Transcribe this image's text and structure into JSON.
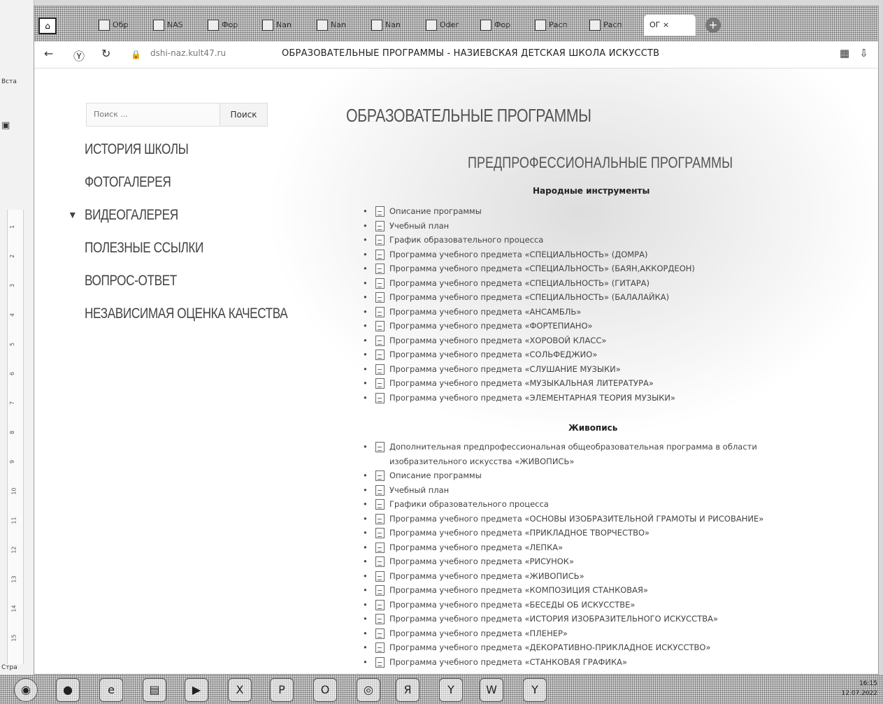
{
  "office": {
    "label_top": "Вста",
    "label_bottom": "Стра"
  },
  "ruler_ticks": [
    "1",
    "2",
    "3",
    "4",
    "5",
    "6",
    "7",
    "8",
    "9",
    "10",
    "11",
    "12",
    "13",
    "14",
    "15"
  ],
  "browser": {
    "tabs": [
      "Обр",
      "NAS",
      "Фор",
      "Nan",
      "Nan",
      "Nan",
      "Oder",
      "Фор",
      "Расп",
      "Расп"
    ],
    "active_tab": "ОГ ×",
    "new_tab": "+",
    "url": "dshi-naz.kult47.ru",
    "title": "ОБРАЗОВАТЕЛЬНЫЕ ПРОГРАММЫ - НАЗИЕВСКАЯ ДЕТСКАЯ ШКОЛА ИСКУССТВ",
    "back": "←",
    "reload": "↻",
    "yandex": "Ⓨ"
  },
  "search": {
    "placeholder": "Поиск ...",
    "button": "Поиск"
  },
  "menu": [
    {
      "label": "ИСТОРИЯ ШКОЛЫ",
      "arrow": false
    },
    {
      "label": "ФОТОГАЛЕРЕЯ",
      "arrow": false
    },
    {
      "label": "ВИДЕОГАЛЕРЕЯ",
      "arrow": true
    },
    {
      "label": "ПОЛЕЗНЫЕ ССЫЛКИ",
      "arrow": false
    },
    {
      "label": "ВОПРОС-ОТВЕТ",
      "arrow": false
    },
    {
      "label": "НЕЗАВИСИМАЯ ОЦЕНКА КАЧЕСТВА",
      "arrow": false
    }
  ],
  "main_title": "ОБРАЗОВАТЕЛЬНЫЕ ПРОГРАММЫ",
  "sub_title": "ПРЕДПРОФЕССИОНАЛЬНЫЕ ПРОГРАММЫ",
  "section1": {
    "heading": "Народные инструменты",
    "items": [
      "Описание программы",
      "Учебный план",
      "График образовательного процесса",
      "Программа учебного предмета «СПЕЦИАЛЬНОСТЬ» (ДОМРА)",
      "Программа учебного предмета «СПЕЦИАЛЬНОСТЬ» (БАЯН,АККОРДЕОН)",
      "Программа учебного предмета «СПЕЦИАЛЬНОСТЬ» (ГИТАРА)",
      "Программа учебного предмета «СПЕЦИАЛЬНОСТЬ» (БАЛАЛАЙКА)",
      "Программа учебного предмета «АНСАМБЛЬ»",
      "Программа учебного предмета «ФОРТЕПИАНО»",
      "Программа учебного предмета «ХОРОВОЙ КЛАСС»",
      "Программа учебного предмета «СОЛЬФЕДЖИО»",
      "Программа учебного предмета «СЛУШАНИЕ МУЗЫКИ»",
      "Программа учебного предмета «МУЗЫКАЛЬНАЯ ЛИТЕРАТУРА»",
      "Программа учебного предмета «ЭЛЕМЕНТАРНАЯ ТЕОРИЯ МУЗЫКИ»"
    ]
  },
  "section2": {
    "heading": "Живопись",
    "items": [
      "Дополнительная предпрофессиональная общеобразовательная программа в области изобразительного искусства «ЖИВОПИСЬ»",
      "Описание программы",
      "Учебный план",
      "Графики образовательного процесса",
      "Программа учебного предмета «ОСНОВЫ ИЗОБРАЗИТЕЛЬНОЙ ГРАМОТЫ И РИСОВАНИЕ»",
      "Программа учебного предмета «ПРИКЛАДНОЕ ТВОРЧЕСТВО»",
      "Программа учебного предмета «ЛЕПКА»",
      "Программа учебного предмета «РИСУНОК»",
      "Программа учебного предмета «ЖИВОПИСЬ»",
      "Программа учебного предмета «КОМПОЗИЦИЯ СТАНКОВАЯ»",
      "Программа учебного предмета «БЕСЕДЫ ОБ ИСКУССТВЕ»",
      "Программа учебного предмета «ИСТОРИЯ ИЗОБРАЗИТЕЛЬНОГО ИСКУССТВА»",
      "Программа учебного предмета «ПЛЕНЕР»",
      "Программа учебного предмета «ДЕКОРАТИВНО-ПРИКЛАДНОЕ ИСКУССТВО»",
      "Программа учебного предмета «СТАНКОВАЯ ГРАФИКА»"
    ]
  },
  "taskbar": {
    "icons": [
      "start-orb-icon",
      "browser-icon",
      "ie-icon",
      "files-icon",
      "media-icon",
      "excel-icon",
      "powerpoint-icon",
      "opera-icon",
      "chrome-icon",
      "yandex-icon",
      "yandex-browser-icon",
      "word-icon",
      "yandex-browser-icon"
    ],
    "glyphs": [
      "◉",
      "●",
      "e",
      "▤",
      "▶",
      "X",
      "P",
      "O",
      "◎",
      "Я",
      "Y",
      "W",
      "Y"
    ],
    "time": "16:15",
    "date": "12.07.2022"
  }
}
